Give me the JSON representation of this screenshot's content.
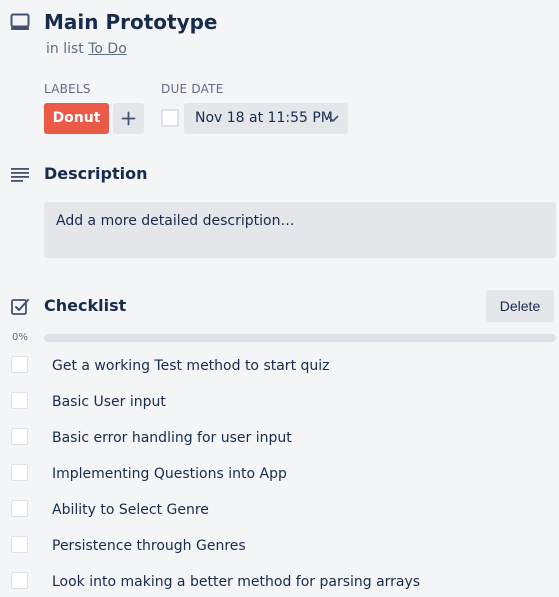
{
  "card": {
    "title": "Main Prototype",
    "in_list_prefix": "in list",
    "list_name": "To Do",
    "icon": "card-icon"
  },
  "labels": {
    "heading": "LABELS",
    "items": [
      {
        "name": "Donut",
        "color": "#eb5a46"
      }
    ],
    "add_icon": "plus-icon"
  },
  "due_date": {
    "heading": "DUE DATE",
    "value": "Nov 18 at 11:55 PM",
    "checked": false
  },
  "description": {
    "heading": "Description",
    "placeholder": "Add a more detailed description…",
    "icon": "description-icon"
  },
  "checklist": {
    "heading": "Checklist",
    "delete_label": "Delete",
    "progress_percent": 0,
    "progress_label": "0%",
    "icon": "checklist-icon",
    "items": [
      {
        "text": "Get a working Test method to start quiz",
        "checked": false
      },
      {
        "text": "Basic User input",
        "checked": false
      },
      {
        "text": "Basic error handling for user input",
        "checked": false
      },
      {
        "text": "Implementing Questions into App",
        "checked": false
      },
      {
        "text": "Ability to Select Genre",
        "checked": false
      },
      {
        "text": "Persistence through Genres",
        "checked": false
      },
      {
        "text": "Look into making a better method for parsing arrays",
        "checked": false
      }
    ]
  },
  "colors": {
    "background": "#f4f5f7",
    "label_red": "#eb5a46",
    "button_gray": "#e4e6ea",
    "text_primary": "#172b4d",
    "text_secondary": "#5e6c84"
  }
}
